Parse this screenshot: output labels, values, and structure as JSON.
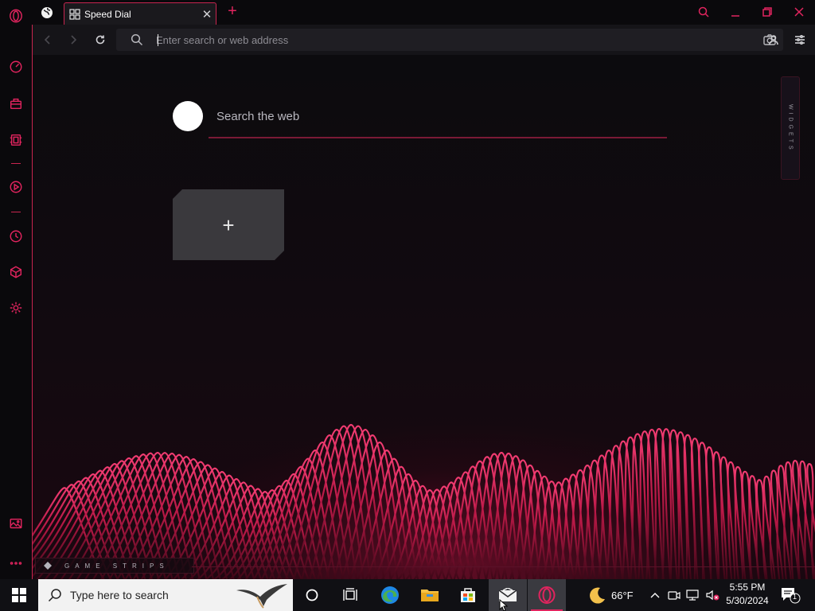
{
  "browser": {
    "tab": {
      "title": "Speed Dial"
    },
    "address_bar": {
      "placeholder": "Enter search or web address",
      "value": ""
    }
  },
  "speed_dial": {
    "search_placeholder": "Search the web",
    "add_tile_symbol": "+",
    "widgets_label": "WIDGETS",
    "game_strips_label": "GAME STRIPS"
  },
  "sidebar": {
    "items": [
      "speedometer-icon",
      "briefcase-icon",
      "stack-icon",
      "player-icon",
      "history-icon",
      "cube-icon",
      "settings-icon",
      "wallpaper-icon",
      "more-icon"
    ]
  },
  "taskbar": {
    "search_placeholder": "Type here to search",
    "weather_temp": "66°F",
    "time": "5:55 PM",
    "date": "5/30/2024",
    "notification_count": "1"
  },
  "colors": {
    "accent": "#e0245e",
    "background": "#0b0a0d",
    "tile": "#3a393d"
  }
}
